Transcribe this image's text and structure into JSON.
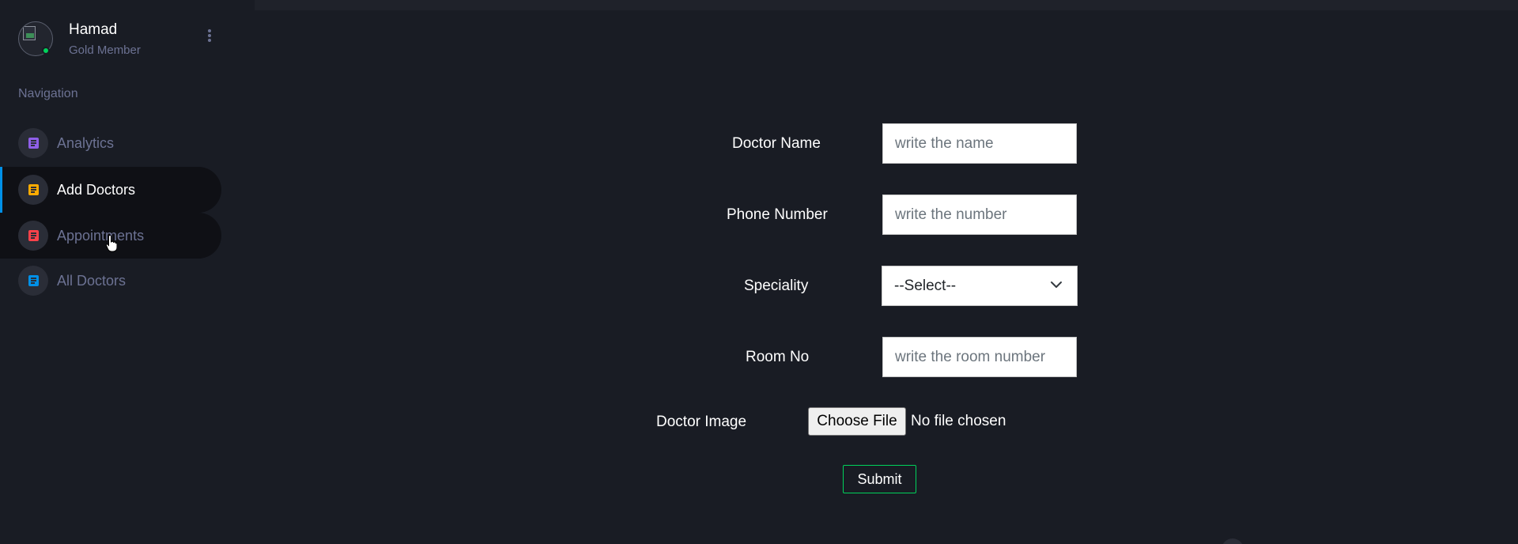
{
  "profile": {
    "name": "Hamad",
    "subtitle": "Gold Member",
    "avatar_icon": "broken-image-icon",
    "status_color": "#00d25b"
  },
  "navigation": {
    "heading": "Navigation",
    "items": [
      {
        "label": "Analytics",
        "icon": "document-icon",
        "icon_color": "#8f5fe8",
        "state": "default"
      },
      {
        "label": "Add Doctors",
        "icon": "document-icon",
        "icon_color": "#ffab00",
        "state": "active"
      },
      {
        "label": "Appointments",
        "icon": "document-icon",
        "icon_color": "#fc424a",
        "state": "hover"
      },
      {
        "label": "All Doctors",
        "icon": "document-icon",
        "icon_color": "#0090e7",
        "state": "default"
      }
    ]
  },
  "form": {
    "doctor_name": {
      "label": "Doctor Name",
      "value": "",
      "placeholder": "write the name"
    },
    "phone_number": {
      "label": "Phone Number",
      "value": "",
      "placeholder": "write the number"
    },
    "speciality": {
      "label": "Speciality",
      "selected": "--Select--"
    },
    "room_no": {
      "label": "Room No",
      "value": "",
      "placeholder": "write the room number"
    },
    "doctor_image": {
      "label": "Doctor Image",
      "button": "Choose File",
      "status": "No file chosen"
    },
    "submit": "Submit"
  },
  "colors": {
    "background": "#191c24",
    "active_indicator": "#0090e7",
    "submit_border": "#00d25b",
    "muted_text": "#6c7293"
  }
}
